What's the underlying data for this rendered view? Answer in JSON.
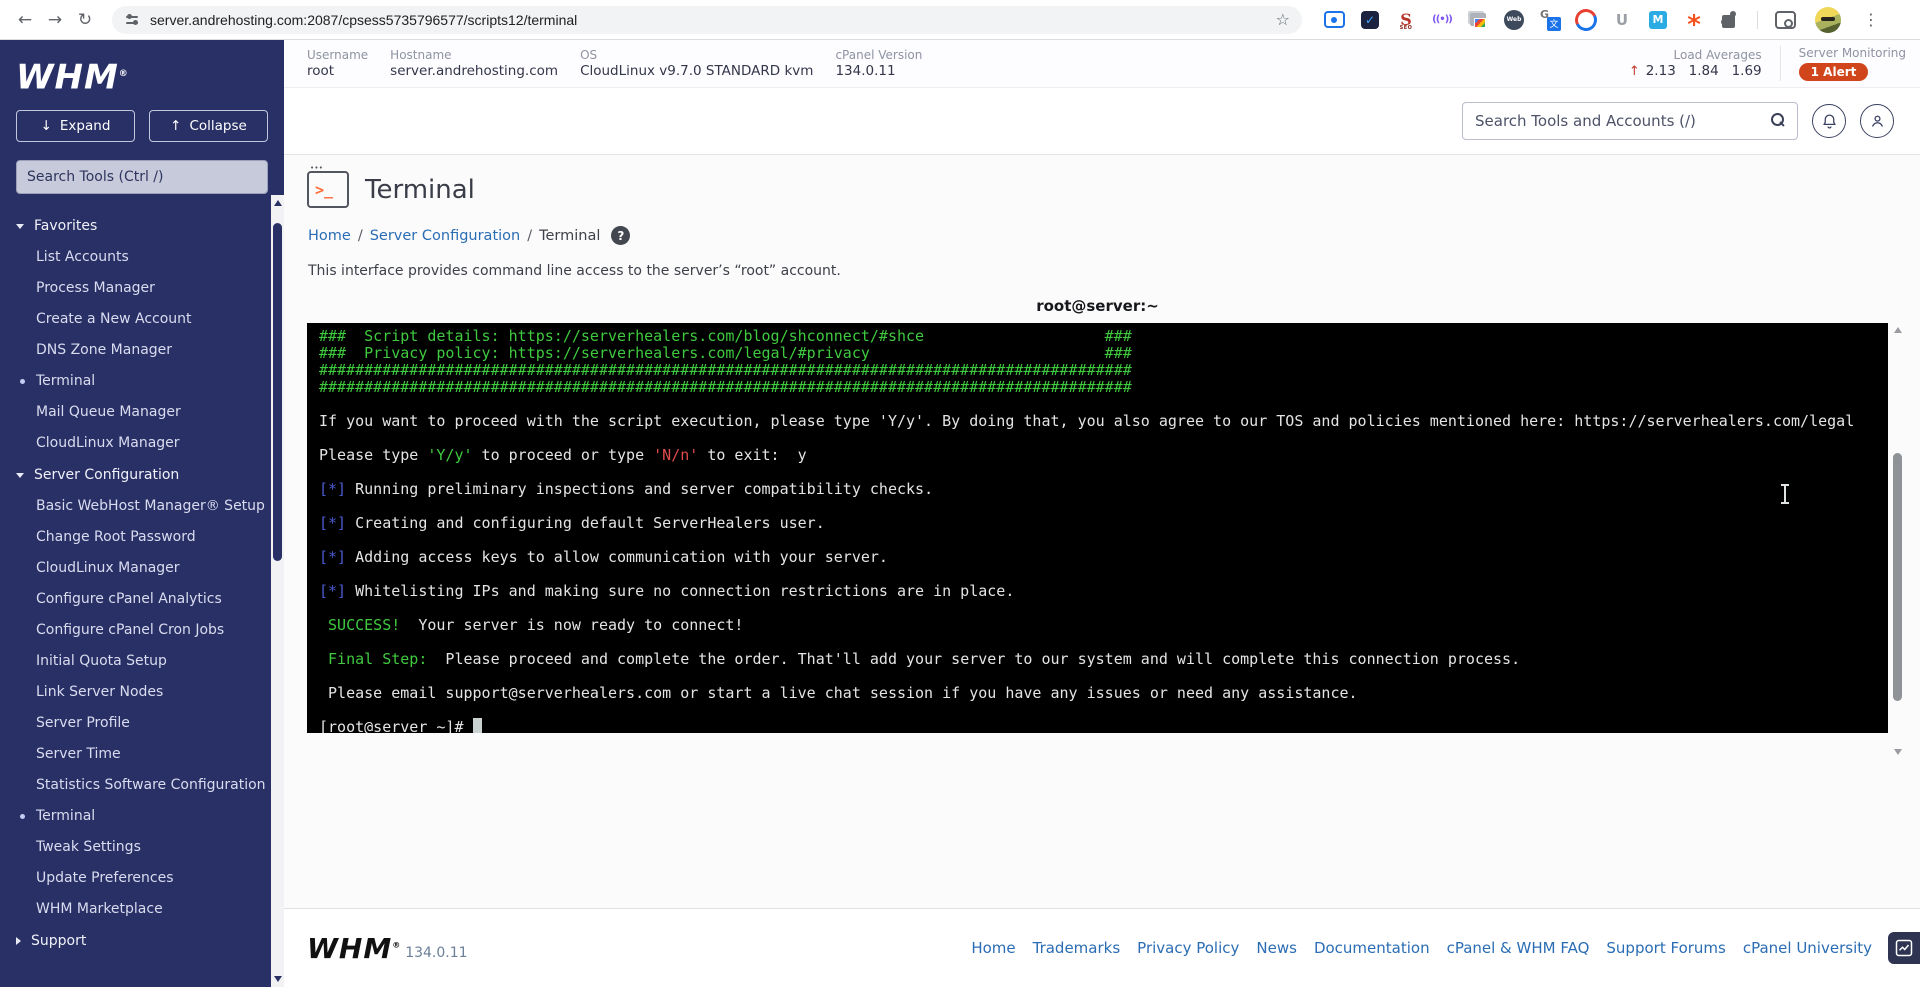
{
  "browser": {
    "url": "server.andrehosting.com:2087/cpsess5735796577/scripts12/terminal",
    "extensions": [
      "record-icon",
      "check-icon",
      "seo-icon",
      "signal-icon",
      "bookmarks-icon",
      "web-badge-icon",
      "translate-icon",
      "ring-icon",
      "u-icon",
      "m-icon",
      "burst-icon"
    ]
  },
  "header": {
    "fields": [
      {
        "label": "Username",
        "value": "root"
      },
      {
        "label": "Hostname",
        "value": "server.andrehosting.com"
      },
      {
        "label": "OS",
        "value": "CloudLinux v9.7.0 STANDARD kvm"
      },
      {
        "label": "cPanel Version",
        "value": "134.0.11"
      }
    ],
    "load": {
      "label": "Load Averages",
      "values": "2.13   1.84   1.69",
      "arrow": "↑"
    },
    "monitoring": {
      "label": "Server Monitoring",
      "badge": "1 Alert"
    },
    "search_placeholder": "Search Tools and Accounts (/)"
  },
  "sidebar": {
    "logo": "WHM",
    "expand_label": "Expand",
    "collapse_label": "Collapse",
    "expand_arrow": "↓",
    "collapse_arrow": "↑",
    "search_placeholder": "Search Tools (Ctrl /)",
    "sections": [
      {
        "label": "Favorites",
        "expanded": true,
        "items": [
          {
            "label": "List Accounts"
          },
          {
            "label": "Process Manager"
          },
          {
            "label": "Create a New Account"
          },
          {
            "label": "DNS Zone Manager"
          },
          {
            "label": "Terminal",
            "active": true
          },
          {
            "label": "Mail Queue Manager"
          },
          {
            "label": "CloudLinux Manager"
          }
        ]
      },
      {
        "label": "Server Configuration",
        "expanded": true,
        "items": [
          {
            "label": "Basic WebHost Manager® Setup"
          },
          {
            "label": "Change Root Password"
          },
          {
            "label": "CloudLinux Manager"
          },
          {
            "label": "Configure cPanel Analytics"
          },
          {
            "label": "Configure cPanel Cron Jobs"
          },
          {
            "label": "Initial Quota Setup"
          },
          {
            "label": "Link Server Nodes"
          },
          {
            "label": "Server Profile"
          },
          {
            "label": "Server Time"
          },
          {
            "label": "Statistics Software Configuration"
          },
          {
            "label": "Terminal",
            "active": true
          },
          {
            "label": "Tweak Settings"
          },
          {
            "label": "Update Preferences"
          },
          {
            "label": "WHM Marketplace"
          }
        ]
      },
      {
        "label": "Support",
        "expanded": false,
        "items": []
      }
    ]
  },
  "page": {
    "title": "Terminal",
    "breadcrumb": [
      "Home",
      "Server Configuration",
      "Terminal"
    ],
    "description": "This interface provides command line access to the server’s “root” account.",
    "terminal_title": "root@server:~"
  },
  "terminal": {
    "lines": [
      [
        {
          "t": "###  Script details: https://serverhealers.com/blog/shconnect/#shce                    ###",
          "c": "g"
        }
      ],
      [
        {
          "t": "###  Privacy policy: https://serverhealers.com/legal/#privacy                          ###",
          "c": "g"
        }
      ],
      [
        {
          "t": "##########################################################################################",
          "c": "g"
        }
      ],
      [
        {
          "t": "##########################################################################################",
          "c": "g"
        }
      ],
      [],
      [
        {
          "t": "If you want to proceed with the script execution, please type 'Y/y'. By doing that, you also agree to our TOS and policies mentioned here: https://serverhealers.com/legal",
          "c": "w"
        }
      ],
      [],
      [
        {
          "t": "Please type ",
          "c": "w"
        },
        {
          "t": "'Y/y'",
          "c": "g"
        },
        {
          "t": " to proceed or type ",
          "c": "w"
        },
        {
          "t": "'N/n'",
          "c": "r"
        },
        {
          "t": " to exit:  y",
          "c": "w"
        }
      ],
      [],
      [
        {
          "t": "[*]",
          "c": "b"
        },
        {
          "t": " Running preliminary inspections and server compatibility checks.",
          "c": "w"
        }
      ],
      [],
      [
        {
          "t": "[*]",
          "c": "b"
        },
        {
          "t": " Creating and configuring default ServerHealers user.",
          "c": "w"
        }
      ],
      [],
      [
        {
          "t": "[*]",
          "c": "b"
        },
        {
          "t": " Adding access keys to allow communication with your server.",
          "c": "w"
        }
      ],
      [],
      [
        {
          "t": "[*]",
          "c": "b"
        },
        {
          "t": " Whitelisting IPs and making sure no connection restrictions are in place.",
          "c": "w"
        }
      ],
      [],
      [
        {
          "t": " SUCCESS! ",
          "c": "g"
        },
        {
          "t": " Your server is now ready to connect!",
          "c": "w"
        }
      ],
      [],
      [
        {
          "t": " Final Step: ",
          "c": "g"
        },
        {
          "t": " Please proceed and complete the order. That'll add your server to our system and will complete this connection process.",
          "c": "w"
        }
      ],
      [],
      [
        {
          "t": " Please email support@serverhealers.com or start a live chat session if you have any issues or need any assistance.",
          "c": "w"
        }
      ],
      [],
      [
        {
          "t": "[root@server ~]# ",
          "c": "w"
        },
        {
          "t": " ",
          "c": "cur"
        }
      ]
    ]
  },
  "footer": {
    "version": "134.0.11",
    "links": [
      "Home",
      "Trademarks",
      "Privacy Policy",
      "News",
      "Documentation",
      "cPanel & WHM FAQ",
      "Support Forums",
      "cPanel University"
    ]
  }
}
